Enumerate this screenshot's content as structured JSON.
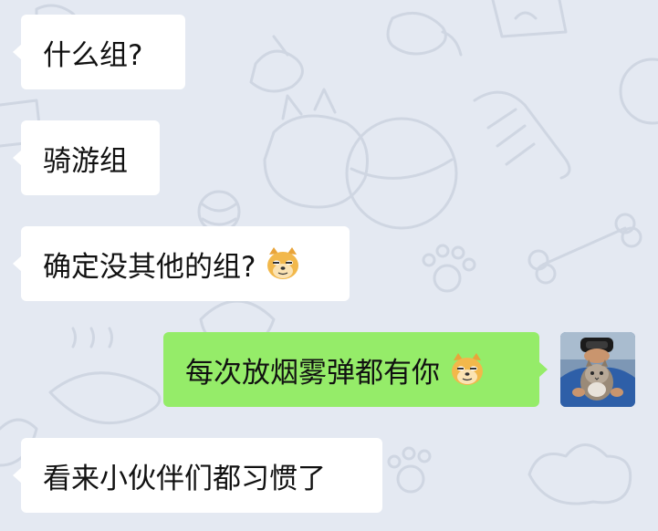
{
  "chat": {
    "messages": [
      {
        "text": "什么组?",
        "side": "incoming",
        "emoji": ""
      },
      {
        "text": "骑游组",
        "side": "incoming",
        "emoji": ""
      },
      {
        "text": "确定没其他的组?",
        "side": "incoming",
        "emoji": "doge-emoji"
      },
      {
        "text": "每次放烟雾弹都有你",
        "side": "outgoing",
        "emoji": "doge-emoji"
      },
      {
        "text": "看来小伙伴们都习惯了",
        "side": "incoming",
        "emoji": ""
      }
    ]
  },
  "colors": {
    "background": "#e4e9f2",
    "incoming_bubble": "#ffffff",
    "outgoing_bubble": "#95ec69",
    "doodle_stroke": "#cfd6e2"
  },
  "icons": {
    "emoji": "doge-emoji",
    "avatar": "user-avatar-cat-photo"
  }
}
